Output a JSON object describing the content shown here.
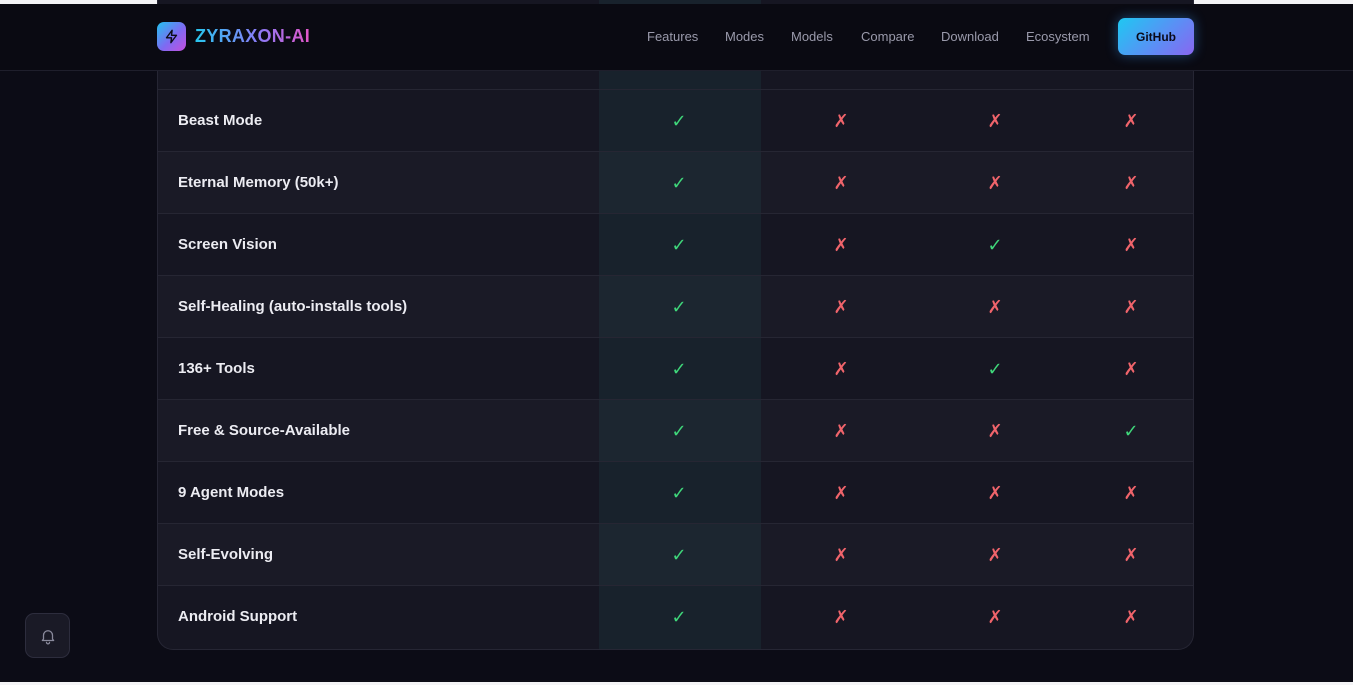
{
  "brand": {
    "name": "ZYRAXON-AI",
    "logo_icon": "lightning-bolt-icon"
  },
  "nav": {
    "links": [
      "Features",
      "Modes",
      "Models",
      "Compare",
      "Download",
      "Ecosystem"
    ],
    "github_label": "GitHub"
  },
  "table": {
    "check_symbol": "✓",
    "cross_symbol": "✗",
    "colors": {
      "check": "#3fd77a",
      "cross": "#f0646b",
      "highlight": "#1c383c"
    },
    "rows": [
      {
        "feature": "Beast Mode",
        "values": [
          true,
          false,
          false,
          false
        ]
      },
      {
        "feature": "Eternal Memory (50k+)",
        "values": [
          true,
          false,
          false,
          false
        ]
      },
      {
        "feature": "Screen Vision",
        "values": [
          true,
          false,
          true,
          false
        ]
      },
      {
        "feature": "Self-Healing (auto-installs tools)",
        "values": [
          true,
          false,
          false,
          false
        ]
      },
      {
        "feature": "136+ Tools",
        "values": [
          true,
          false,
          true,
          false
        ]
      },
      {
        "feature": "Free & Source-Available",
        "values": [
          true,
          false,
          false,
          true
        ]
      },
      {
        "feature": "9 Agent Modes",
        "values": [
          true,
          false,
          false,
          false
        ]
      },
      {
        "feature": "Self-Evolving",
        "values": [
          true,
          false,
          false,
          false
        ]
      },
      {
        "feature": "Android Support",
        "values": [
          true,
          false,
          false,
          false
        ]
      }
    ]
  },
  "notification_button": {
    "icon": "bell-icon"
  }
}
